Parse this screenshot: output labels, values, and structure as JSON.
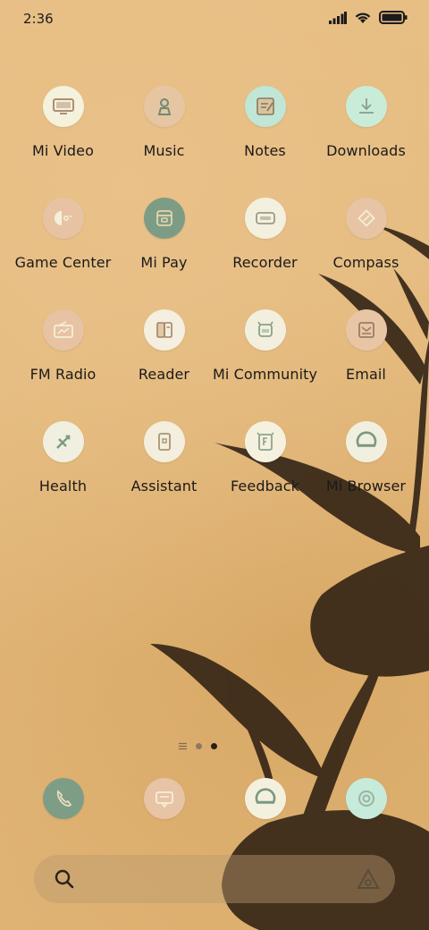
{
  "status": {
    "time": "2:36"
  },
  "apps": [
    [
      {
        "label": "Mi Video",
        "icon": "tv-icon",
        "bg": "#f4f1dc"
      },
      {
        "label": "Music",
        "icon": "music-icon",
        "bg": "#e6c6a2"
      },
      {
        "label": "Notes",
        "icon": "notes-icon",
        "bg": "#bfe6d6"
      },
      {
        "label": "Downloads",
        "icon": "download-icon",
        "bg": "#c9ecd9"
      }
    ],
    [
      {
        "label": "Game Center",
        "icon": "gamepad-icon",
        "bg": "#e8c3a3"
      },
      {
        "label": "Mi Pay",
        "icon": "wallet-icon",
        "bg": "#7d9c86"
      },
      {
        "label": "Recorder",
        "icon": "recorder-icon",
        "bg": "#f4f0df"
      },
      {
        "label": "Compass",
        "icon": "compass-icon",
        "bg": "#e7c4a4"
      }
    ],
    [
      {
        "label": "FM Radio",
        "icon": "radio-icon",
        "bg": "#e7c3a4"
      },
      {
        "label": "Reader",
        "icon": "book-icon",
        "bg": "#f4efde"
      },
      {
        "label": "Mi Community",
        "icon": "community-icon",
        "bg": "#f2efde"
      },
      {
        "label": "Email",
        "icon": "email-icon",
        "bg": "#e8c5a5"
      }
    ],
    [
      {
        "label": "Health",
        "icon": "health-icon",
        "bg": "#f1efdf"
      },
      {
        "label": "Assistant",
        "icon": "assistant-icon",
        "bg": "#f3eedd"
      },
      {
        "label": "Feedback",
        "icon": "feedback-icon",
        "bg": "#f4f1df"
      },
      {
        "label": "Mi Browser",
        "icon": "browser-icon",
        "bg": "#f1efdf"
      }
    ]
  ],
  "dock": [
    {
      "icon": "phone-icon",
      "bg": "#7e9d87"
    },
    {
      "icon": "messages-icon",
      "bg": "#e7c4a5"
    },
    {
      "icon": "browser-icon",
      "bg": "#f4f0de"
    },
    {
      "icon": "camera-icon",
      "bg": "#c6ebda"
    }
  ]
}
